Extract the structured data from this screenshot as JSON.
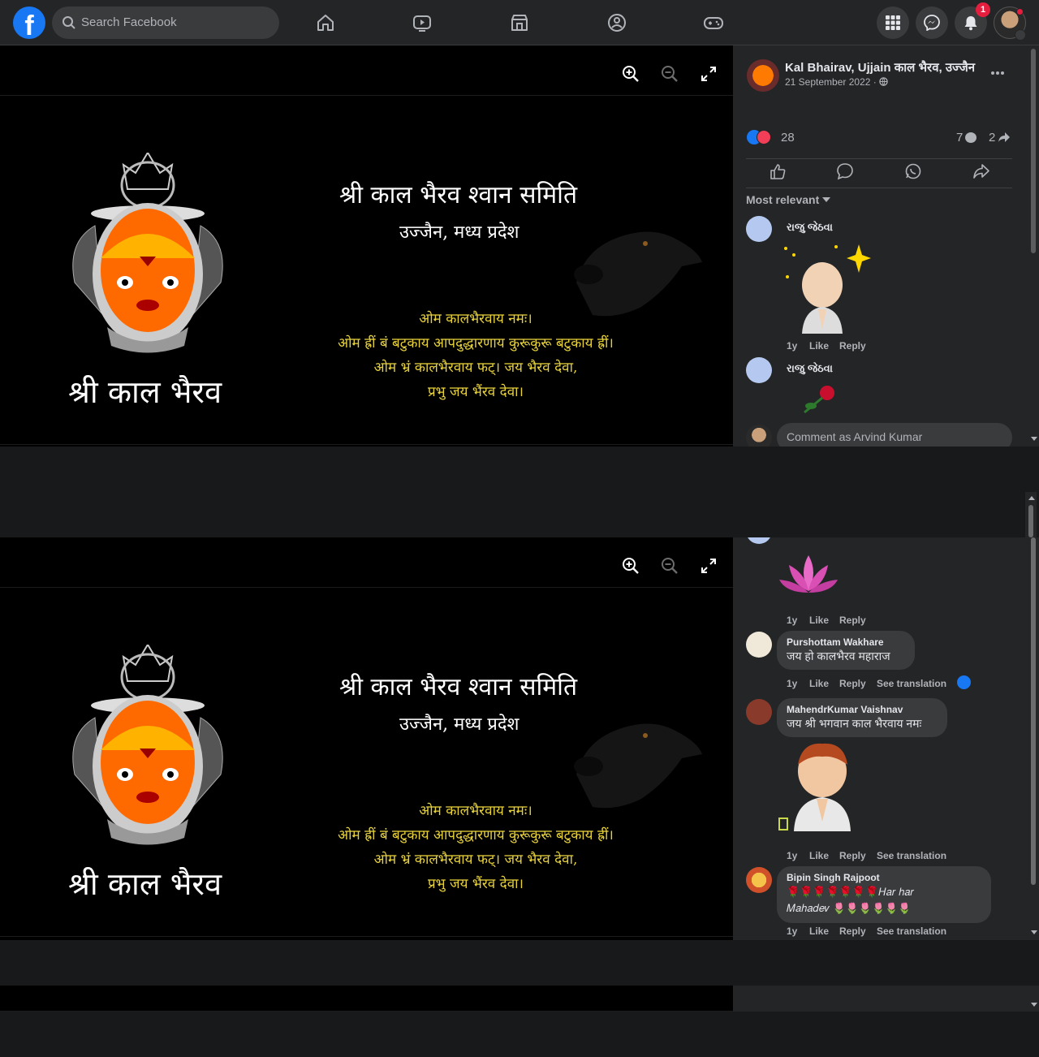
{
  "topbar": {
    "search_placeholder": "Search Facebook",
    "notification_count": "1",
    "logo_letter": "f",
    "icons": [
      "home-icon",
      "watch-icon",
      "marketplace-icon",
      "groups-icon",
      "gaming-icon",
      "menu-grid-icon",
      "messenger-icon",
      "bell-icon"
    ]
  },
  "photo": {
    "title": "श्री काल भैरव श्वान समिति",
    "subtitle": "उज्जैन, मध्य प्रदेश",
    "mantra": [
      "ओम कालभैरवाय नमः।",
      "ओम ह्रीं बं बटुकाय आपदुद्धारणाय कुरूकुरू बटुकाय ह्रीं।",
      "ओम भ्रं कालभैरवाय फट्। जय भैरव देवा,",
      "प्रभु जय भैंरव देवा।"
    ],
    "deity_name": "श्री काल भैरव"
  },
  "post": {
    "page_name": "Kal Bhairav, Ujjain काल भैरव, उज्जैन",
    "date": "21 September 2022 ·",
    "reactions": "28",
    "comments": "7",
    "shares": "2",
    "sort": "Most relevant",
    "comment_placeholder": "Comment as Arvind Kumar"
  },
  "comments_top": [
    {
      "name": "રાજુ જેઠવા",
      "time": "1y",
      "like": "Like",
      "reply": "Reply"
    },
    {
      "name": "રાજુ જેઠવા"
    }
  ],
  "comments_bottom": [
    {
      "time": "1y",
      "like": "Like",
      "reply": "Reply"
    },
    {
      "name": "Purshottam Wakhare",
      "text": "जय हो कालभैरव महाराज",
      "time": "1y",
      "like": "Like",
      "reply": "Reply",
      "translate": "See translation"
    },
    {
      "name": "MahendrKumar Vaishnav",
      "text": "जय श्री भगवान काल भैरवाय नमः",
      "time": "1y",
      "like": "Like",
      "reply": "Reply",
      "translate": "See translation"
    },
    {
      "name": "Bipin Singh Rajpoot",
      "text1": "🌹🌹🌹🌹🌹🌹🌹𝐻𝑎𝑟 ℎ𝑎𝑟",
      "text2": "𝑀𝑎ℎ𝑎𝑑𝑒𝑣 🌷🌷🌷🌷🌷🌷",
      "time": "1y",
      "like": "Like",
      "reply": "Reply",
      "translate": "See translation"
    }
  ],
  "colors": {
    "accent": "#1877f2",
    "mantra": "#e8d23c",
    "badge": "#e41e3f",
    "panel": "#242526"
  }
}
